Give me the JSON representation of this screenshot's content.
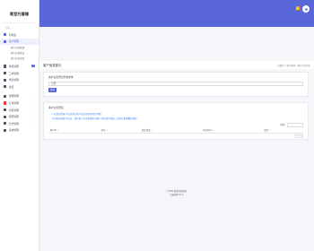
{
  "brand": {
    "name": "教室托管端"
  },
  "sidebar": {
    "section_label": "导航",
    "items": [
      {
        "label": "控制台",
        "icon": "dashboard-icon",
        "color": "#5a67d8"
      },
      {
        "label": "客户管理",
        "icon": "users-icon",
        "color": "#5a67d8",
        "active": true
      },
      {
        "label": "客户信息管理",
        "sub": true
      },
      {
        "label": "客户信息登记",
        "sub": true
      },
      {
        "label": "客户信息调查",
        "sub": true
      },
      {
        "label": "审核管理",
        "icon": "audit-icon",
        "color": "#4a5568",
        "badge": "3"
      },
      {
        "label": "工单管理",
        "icon": "ticket-icon",
        "color": "#4a5568"
      },
      {
        "label": "学生管理",
        "icon": "student-icon",
        "color": "#4a5568"
      },
      {
        "label": "社区",
        "icon": "community-icon",
        "color": "#4a5568"
      },
      {
        "label": "课程管理",
        "icon": "course-icon",
        "color": "#4a5568"
      },
      {
        "label": "订单管理",
        "icon": "order-icon",
        "color": "#e53e3e"
      },
      {
        "label": "项目管理",
        "icon": "project-icon",
        "color": "#4a5568"
      },
      {
        "label": "权限管理",
        "icon": "lock-icon",
        "color": "#4a5568"
      },
      {
        "label": "日志管理",
        "icon": "log-icon",
        "color": "#4a5568"
      },
      {
        "label": "系统管理",
        "icon": "gear-icon",
        "color": "#4a5568"
      }
    ]
  },
  "page": {
    "title": "客户信息登记",
    "breadcrumb": "控制台 > 客户管理 > 客户信息登记"
  },
  "filter_card": {
    "title": "客户信息登记查询条件",
    "select_value": "全部",
    "query_button": "查询"
  },
  "table_card": {
    "title": "客户信息登记",
    "hints": [
      "1.已登记的客户信息请在客户信息登记中进行查看",
      "2.如需修改客户信息，请在客户信息管理中对客户信息进行修改，修改后需要重新审核"
    ],
    "search_label": "搜索:",
    "columns": [
      "客户ID",
      "姓名",
      "联系电话",
      "登记时间",
      "操作"
    ]
  },
  "footer": {
    "line1": "© 2024 教室托管系统",
    "line2": "当前版本 V1.0"
  }
}
